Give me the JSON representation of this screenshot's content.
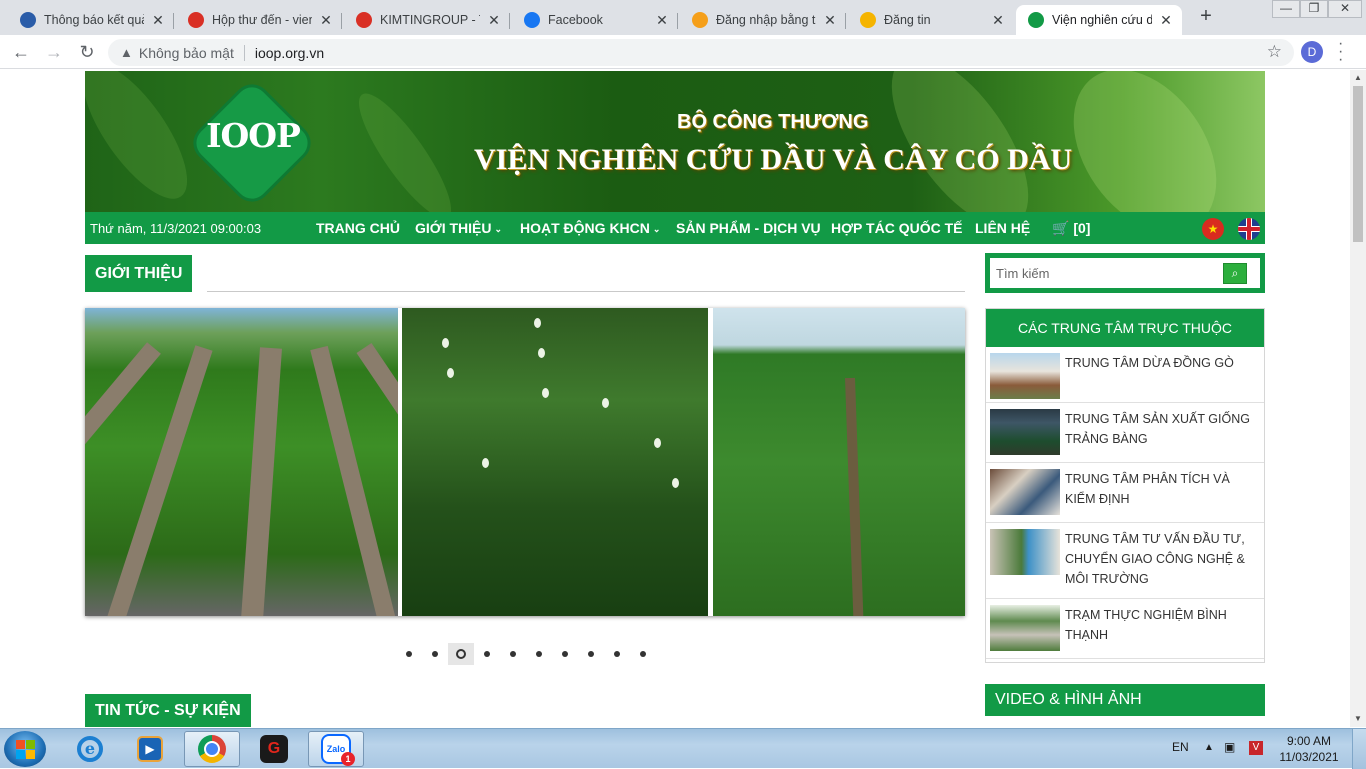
{
  "browser": {
    "tabs": [
      {
        "title": "Thông báo kết quả",
        "favicon_color": "#2a5ca8",
        "favicon": "seal-icon"
      },
      {
        "title": "Hộp thư đến - vienc",
        "favicon_color": "#d93025",
        "favicon": "gmail-icon"
      },
      {
        "title": "KIMTINGROUP - TH",
        "favicon_color": "#d93025",
        "favicon": "gmail-icon"
      },
      {
        "title": "Facebook",
        "favicon_color": "#1877f2",
        "favicon": "facebook-icon"
      },
      {
        "title": "Đăng nhập bằng tà",
        "favicon_color": "#f59f1a",
        "favicon": "star-icon"
      },
      {
        "title": "Đăng tin",
        "favicon_color": "#f5b400",
        "favicon": "tot-icon"
      },
      {
        "title": "Viện nghiên cứu dầ",
        "favicon_color": "#129a46",
        "favicon": "ioop-icon"
      }
    ],
    "active_tab": 6,
    "security_label": "Không bảo mật",
    "url": "ioop.org.vn",
    "profile_initial": "D"
  },
  "header": {
    "logo_text": "IOOP",
    "ministry": "BỘ CÔNG THƯƠNG",
    "institute": "VIỆN NGHIÊN CỨU DẦU VÀ CÂY CÓ DẦU"
  },
  "nav": {
    "datetime": "Thứ năm, 11/3/2021 09:00:03",
    "items": [
      {
        "label": "TRANG CHỦ",
        "dropdown": false
      },
      {
        "label": "GIỚI THIỆU",
        "dropdown": true
      },
      {
        "label": "HOẠT ĐỘNG KHCN",
        "dropdown": true
      },
      {
        "label": "SẢN PHẨM - DỊCH VỤ",
        "dropdown": false
      },
      {
        "label": "HỢP TÁC QUỐC TẾ",
        "dropdown": false
      },
      {
        "label": "LIÊN HỆ",
        "dropdown": false
      }
    ],
    "cart": "[0]"
  },
  "main": {
    "intro_heading": "GIỚI THIỆU",
    "slider_dot_count": 10,
    "slider_active_dot": 3,
    "news_heading": "TIN TỨC - SỰ KIỆN"
  },
  "sidebar": {
    "search_placeholder": "Tìm kiếm",
    "centers_heading": "CÁC TRUNG TÂM TRỰC THUỘC",
    "centers": [
      {
        "name": "TRUNG TÂM DỪA ĐỒNG GÒ"
      },
      {
        "name": "TRUNG TÂM SẢN XUẤT GIỐNG TRẢNG BÀNG"
      },
      {
        "name": "TRUNG TÂM PHÂN TÍCH VÀ KIỂM ĐỊNH"
      },
      {
        "name": "TRUNG TÂM TƯ VẤN ĐẦU TƯ, CHUYỂN GIAO CÔNG NGHỆ & MÔI TRƯỜNG"
      },
      {
        "name": "TRẠM THỰC NGHIỆM BÌNH THẠNH"
      }
    ],
    "video_heading": "VIDEO & HÌNH ẢNH"
  },
  "taskbar": {
    "language": "EN",
    "time": "9:00 AM",
    "date": "11/03/2021",
    "zalo_label": "Zalo",
    "zalo_badge": "1"
  },
  "colors": {
    "brand_green": "#129a46",
    "banner_green": "#1f6417"
  }
}
